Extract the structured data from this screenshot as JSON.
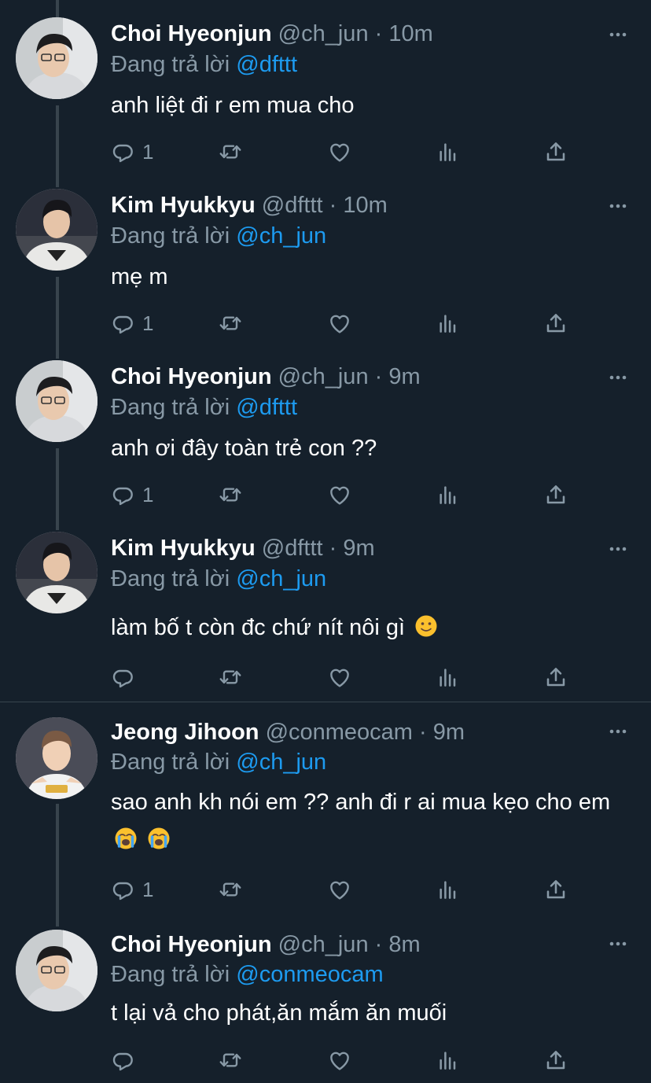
{
  "colors": {
    "background": "#15202b",
    "text": "#ffffff",
    "muted": "#8899a6",
    "mention": "#1d9bf0",
    "thread_line": "#38444d"
  },
  "icons": [
    "reply-icon",
    "retweet-icon",
    "like-icon",
    "analytics-icon",
    "share-icon",
    "more-options-icon"
  ],
  "tweets": [
    {
      "name": "Choi Hyeonjun",
      "handle": "@ch_jun",
      "sep": " · ",
      "time": "10m",
      "reply_prefix": "Đang trả lời ",
      "reply_to": "@dfttt",
      "text": "anh liệt đi r em mua cho",
      "reply_count": "1",
      "emojis": ""
    },
    {
      "name": "Kim Hyukkyu",
      "handle": "@dfttt",
      "sep": " · ",
      "time": "10m",
      "reply_prefix": "Đang trả lời ",
      "reply_to": "@ch_jun",
      "text": "mẹ m",
      "reply_count": "1",
      "emojis": ""
    },
    {
      "name": "Choi Hyeonjun",
      "handle": "@ch_jun",
      "sep": " · ",
      "time": "9m",
      "reply_prefix": "Đang trả lời ",
      "reply_to": "@dfttt",
      "text": "anh ơi đây toàn trẻ con ??",
      "reply_count": "1",
      "emojis": ""
    },
    {
      "name": "Kim Hyukkyu",
      "handle": "@dfttt",
      "sep": " · ",
      "time": "9m",
      "reply_prefix": "Đang trả lời ",
      "reply_to": "@ch_jun",
      "text": "làm bố t còn đc chứ nít nôi gì",
      "reply_count": "",
      "emojis": "slightly-smiling-face"
    },
    {
      "name": "Jeong Jihoon",
      "handle": "@conmeocam",
      "sep": " · ",
      "time": "9m",
      "reply_prefix": "Đang trả lời ",
      "reply_to": "@ch_jun",
      "text": "sao anh kh nói em ?? anh đi r ai mua kẹo cho em",
      "reply_count": "1",
      "emojis": "loudly-crying-face loudly-crying-face"
    },
    {
      "name": "Choi Hyeonjun",
      "handle": "@ch_jun",
      "sep": " · ",
      "time": "8m",
      "reply_prefix": "Đang trả lời ",
      "reply_to": "@conmeocam",
      "text": "t lại vả cho phát,ăn mắm ăn muối",
      "reply_count": "",
      "emojis": ""
    }
  ]
}
